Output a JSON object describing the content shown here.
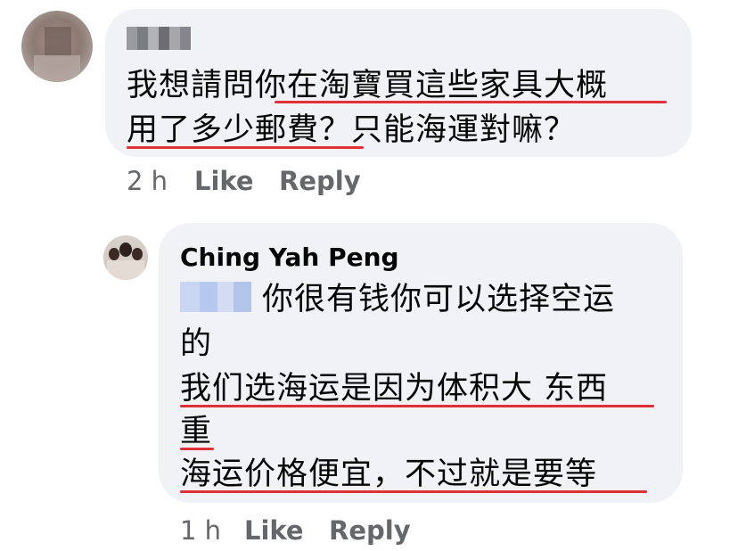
{
  "comment1": {
    "lines": [
      "我想請問你在淘寶買這些家具大概",
      "用了多少郵費？只能海運對嘛？"
    ],
    "time": "2 h",
    "like": "Like",
    "reply": "Reply"
  },
  "comment2": {
    "author": "Ching Yah Peng",
    "line1": "你很有钱你可以选择空运",
    "line2": "的",
    "line3": "我们选海运是因为体积大 东西",
    "line4": "重",
    "line5": "海运价格便宜，不过就是要等",
    "time": "1 h",
    "like": "Like",
    "reply": "Reply"
  },
  "colors": {
    "bubble": "#f0f2f5",
    "underline": "#e0303a",
    "meta": "#65676b"
  }
}
